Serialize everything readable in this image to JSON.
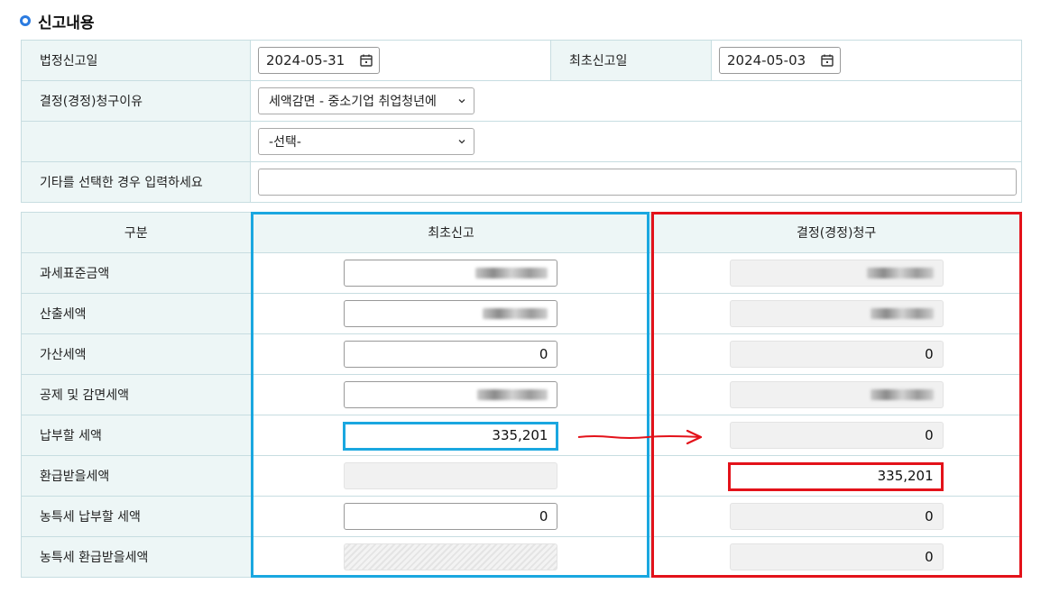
{
  "section": {
    "title": "신고내용"
  },
  "form": {
    "statutory_date_label": "법정신고일",
    "statutory_date_value": "2024-05-31",
    "initial_date_label": "최초신고일",
    "initial_date_value": "2024-05-03",
    "reason_label": "결정(경정)청구이유",
    "reason_value": "세액감면 - 중소기업 취업청년에",
    "reason2_value": "-선택-",
    "other_label": "기타를 선택한 경우 입력하세요",
    "other_value": ""
  },
  "grid": {
    "header_category": "구분",
    "header_initial": "최초신고",
    "header_claim": "결정(경정)청구",
    "rows": [
      {
        "label": "과세표준금액",
        "initial": "",
        "claim": ""
      },
      {
        "label": "산출세액",
        "initial": "",
        "claim": ""
      },
      {
        "label": "가산세액",
        "initial": "0",
        "claim": "0"
      },
      {
        "label": "공제 및 감면세액",
        "initial": "",
        "claim": ""
      },
      {
        "label": "납부할 세액",
        "initial": "335,201",
        "claim": "0"
      },
      {
        "label": "환급받을세액",
        "initial": "",
        "claim": "335,201"
      },
      {
        "label": "농특세 납부할 세액",
        "initial": "0",
        "claim": "0"
      },
      {
        "label": "농특세 환급받을세액",
        "initial": "",
        "claim": "0"
      }
    ]
  },
  "colors": {
    "highlight_blue": "#1aa7e0",
    "highlight_red": "#e3121a",
    "label_bg": "#edf6f6"
  },
  "icons": [
    "circle-bullet-icon",
    "calendar-icon",
    "chevron-down-icon",
    "arrow-right-icon"
  ]
}
